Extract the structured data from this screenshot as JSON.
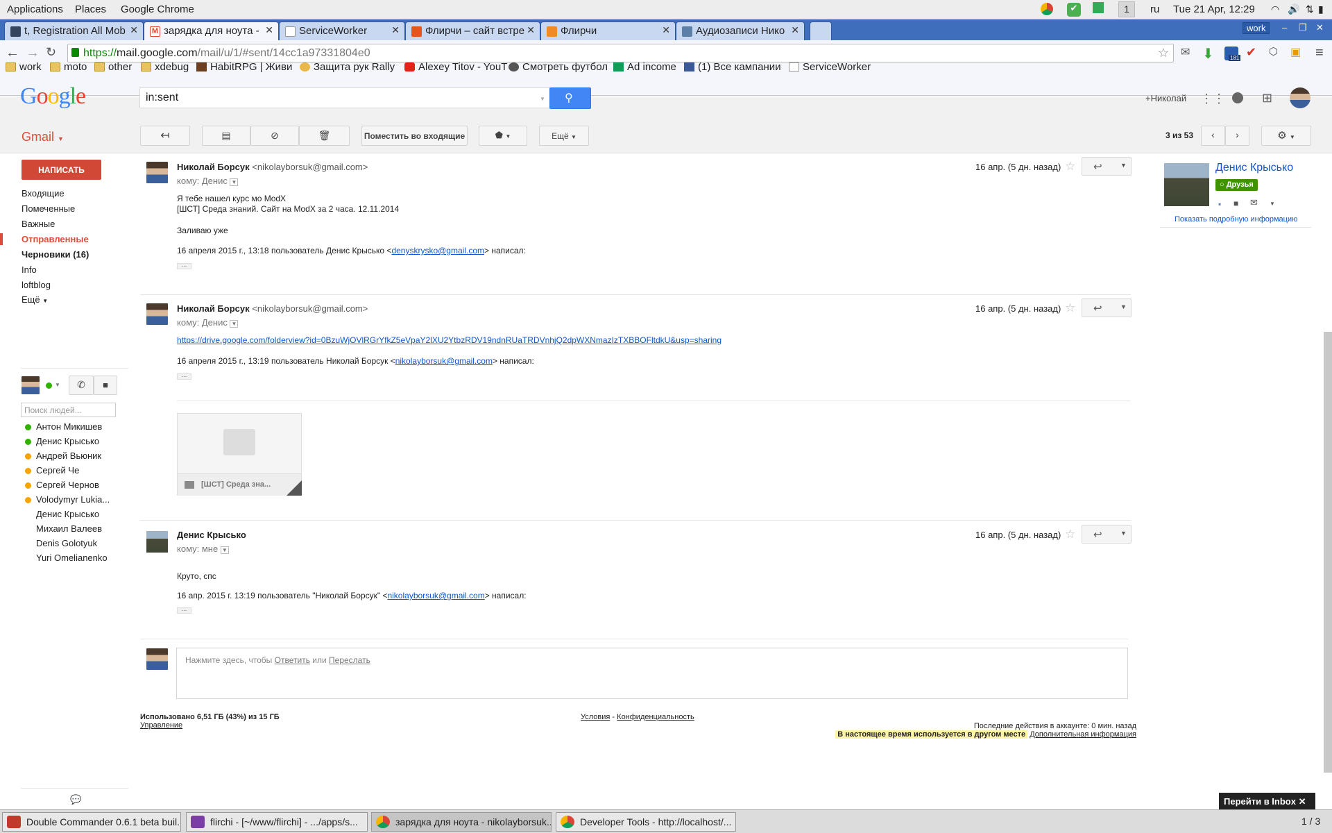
{
  "topbar": {
    "menus": [
      "Applications",
      "Places",
      "Google Chrome"
    ],
    "workspace": "1",
    "lang": "ru",
    "clock": "Tue 21 Apr, 12:29"
  },
  "tabs": [
    {
      "title": "t, Registration All Mob",
      "active": false,
      "icon": "tumblr-icon"
    },
    {
      "title": "зарядка для ноута -",
      "active": true,
      "icon": "gmail-icon"
    },
    {
      "title": "ServiceWorker",
      "active": false,
      "icon": "doc-icon"
    },
    {
      "title": "Флирчи – сайт встре",
      "active": false,
      "icon": "flirchi-icon"
    },
    {
      "title": "Флирчи",
      "active": false,
      "icon": "flirchi-icon"
    },
    {
      "title": "Аудиозаписи Нико",
      "active": false,
      "icon": "vk-icon"
    }
  ],
  "window_label": "work",
  "url": {
    "scheme": "https://",
    "host": "mail.google.com",
    "path": "/mail/u/1/#sent/14cc1a97331804e0"
  },
  "extension_badge": "181",
  "bookmarks": [
    {
      "label": "work",
      "icon": "folder"
    },
    {
      "label": "moto",
      "icon": "folder"
    },
    {
      "label": "other",
      "icon": "folder"
    },
    {
      "label": "xdebug",
      "icon": "folder"
    },
    {
      "label": "HabitRPG | Живи",
      "icon": "habitrpg"
    },
    {
      "label": "Защита рук Rally",
      "icon": "site"
    },
    {
      "label": "Alexey Titov - YouT",
      "icon": "youtube"
    },
    {
      "label": "Смотреть футбол",
      "icon": "site"
    },
    {
      "label": "Ad income",
      "icon": "sheet"
    },
    {
      "label": "(1) Все кампании",
      "icon": "facebook"
    },
    {
      "label": "ServiceWorker",
      "icon": "doc"
    }
  ],
  "google": {
    "logo": "Google",
    "search_value": "in:sent",
    "user": "+Николай"
  },
  "toolbar": {
    "move_inbox": "Поместить во входящие",
    "more": "Ещё",
    "counter": "3 из 53"
  },
  "gmail_label": "Gmail",
  "compose": "НАПИСАТЬ",
  "nav": [
    "Входящие",
    "Помеченные",
    "Важные",
    "Отправленные",
    "Черновики (16)",
    "Info",
    "loftblog",
    "Ещё"
  ],
  "people_search_placeholder": "Поиск людей...",
  "contacts": [
    {
      "name": "Антон Микишев",
      "status": "online"
    },
    {
      "name": "Денис Крысько",
      "status": "online"
    },
    {
      "name": "Андрей Вьюник",
      "status": "away"
    },
    {
      "name": "Сергей Че",
      "status": "away"
    },
    {
      "name": "Сергей Чернов",
      "status": "away"
    },
    {
      "name": "Volodymyr Lukia...",
      "status": "away"
    },
    {
      "name": "Денис Крысько",
      "status": "none"
    },
    {
      "name": "Михаил Валеев",
      "status": "none"
    },
    {
      "name": "Denis Golotyuk",
      "status": "none"
    },
    {
      "name": "Yuri Omelianenko",
      "status": "none"
    }
  ],
  "messages": [
    {
      "sender": "Николай Борсук",
      "email": "<nikolayborsuk@gmail.com>",
      "to": "кому: Денис",
      "date": "16 апр. (5 дн. назад)",
      "line1": "Я тебе нашел курс мо ModX",
      "line2": "[ШСТ] Среда знаний. Сайт на ModX за 2 часа. 12.11.2014",
      "line3": "Заливаю уже",
      "quote_pre": "16 апреля 2015 г., 13:18 пользователь Денис Крысько <",
      "quote_link": "denyskrysko@gmail.com",
      "quote_post": "> написал:"
    },
    {
      "sender": "Николай Борсук",
      "email": "<nikolayborsuk@gmail.com>",
      "to": "кому: Денис",
      "date": "16 апр. (5 дн. назад)",
      "link": "https://drive.google.com/folderview?id=0BzuWjOVlRGrYfkZ5eVpaY2lXU2YtbzRDV19ndnRUaTRDVnhjQ2dpWXNmazIzTXBBOFltdkU&usp=sharing",
      "quote_pre": "16 апреля 2015 г., 13:19 пользователь Николай Борсук <",
      "quote_link": "nikolayborsuk@gmail.com",
      "quote_post": "> написал:",
      "attachment": "[ШСТ] Среда зна..."
    },
    {
      "sender": "Денис Крысько",
      "to": "кому: мне",
      "date": "16 апр. (5 дн. назад)",
      "line1": "Круто, спс",
      "quote_pre": "16 апр. 2015 г. 13:19 пользователь \"Николай Борсук\" <",
      "quote_link": "nikolayborsuk@gmail.com",
      "quote_post": "> написал:"
    }
  ],
  "reply": {
    "prefix": "Нажмите здесь, чтобы ",
    "reply": "Ответить",
    "or": " или ",
    "forward": "Переслать"
  },
  "footer": {
    "usage": "Использовано 6,51 ГБ (43%) из 15 ГБ",
    "manage": "Управление",
    "terms": "Условия",
    "sep": "-",
    "privacy": "Конфиденциальность",
    "last_activity": "Последние действия в аккаунте: 0 мин. назад",
    "elsewhere": "В настоящее время используется в другом месте",
    "details": "Дополнительная информация"
  },
  "profile": {
    "name": "Денис Крысько",
    "badge": "Друзья",
    "more": "Показать подробную информацию"
  },
  "inbox_promo": "Перейти в Inbox",
  "taskbar": [
    {
      "title": "Double Commander 0.6.1 beta buil...",
      "active": false
    },
    {
      "title": "flirchi - [~/www/flirchi] - .../apps/s...",
      "active": false
    },
    {
      "title": "зарядка для ноута - nikolayborsuk...",
      "active": true
    },
    {
      "title": "Developer Tools - http://localhost/...",
      "active": false
    }
  ],
  "workspace_pager": "1 / 3",
  "colors": {
    "gmail_red": "#dd4b39",
    "compose": "#d14836",
    "google_blue": "#4285f4",
    "tab_strip": "#3f6ebd",
    "friends": "#3d9400"
  }
}
